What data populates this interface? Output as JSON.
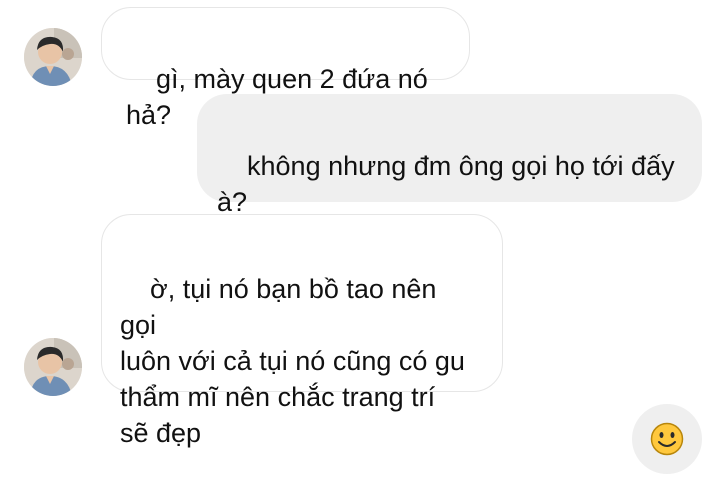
{
  "conversation": {
    "messages": [
      {
        "sender": "other",
        "text": "gì, mày quen 2 đứa nó hả?"
      },
      {
        "sender": "me",
        "text": "không nhưng đm ông gọi họ tới đấy\nà?"
      },
      {
        "sender": "other",
        "text": "ờ, tụi nó bạn bồ tao nên gọi\nluôn với cả tụi nó cũng có gu\nthẩm mĩ nên chắc trang trí\nsẽ đẹp"
      }
    ]
  },
  "composer": {
    "reaction_icon": "smiley-face-icon"
  },
  "colors": {
    "outgoing_bubble": "#efefef",
    "incoming_bubble_border": "#e6e6e6",
    "text": "#111111",
    "emoji_yellow": "#ffc83d"
  }
}
